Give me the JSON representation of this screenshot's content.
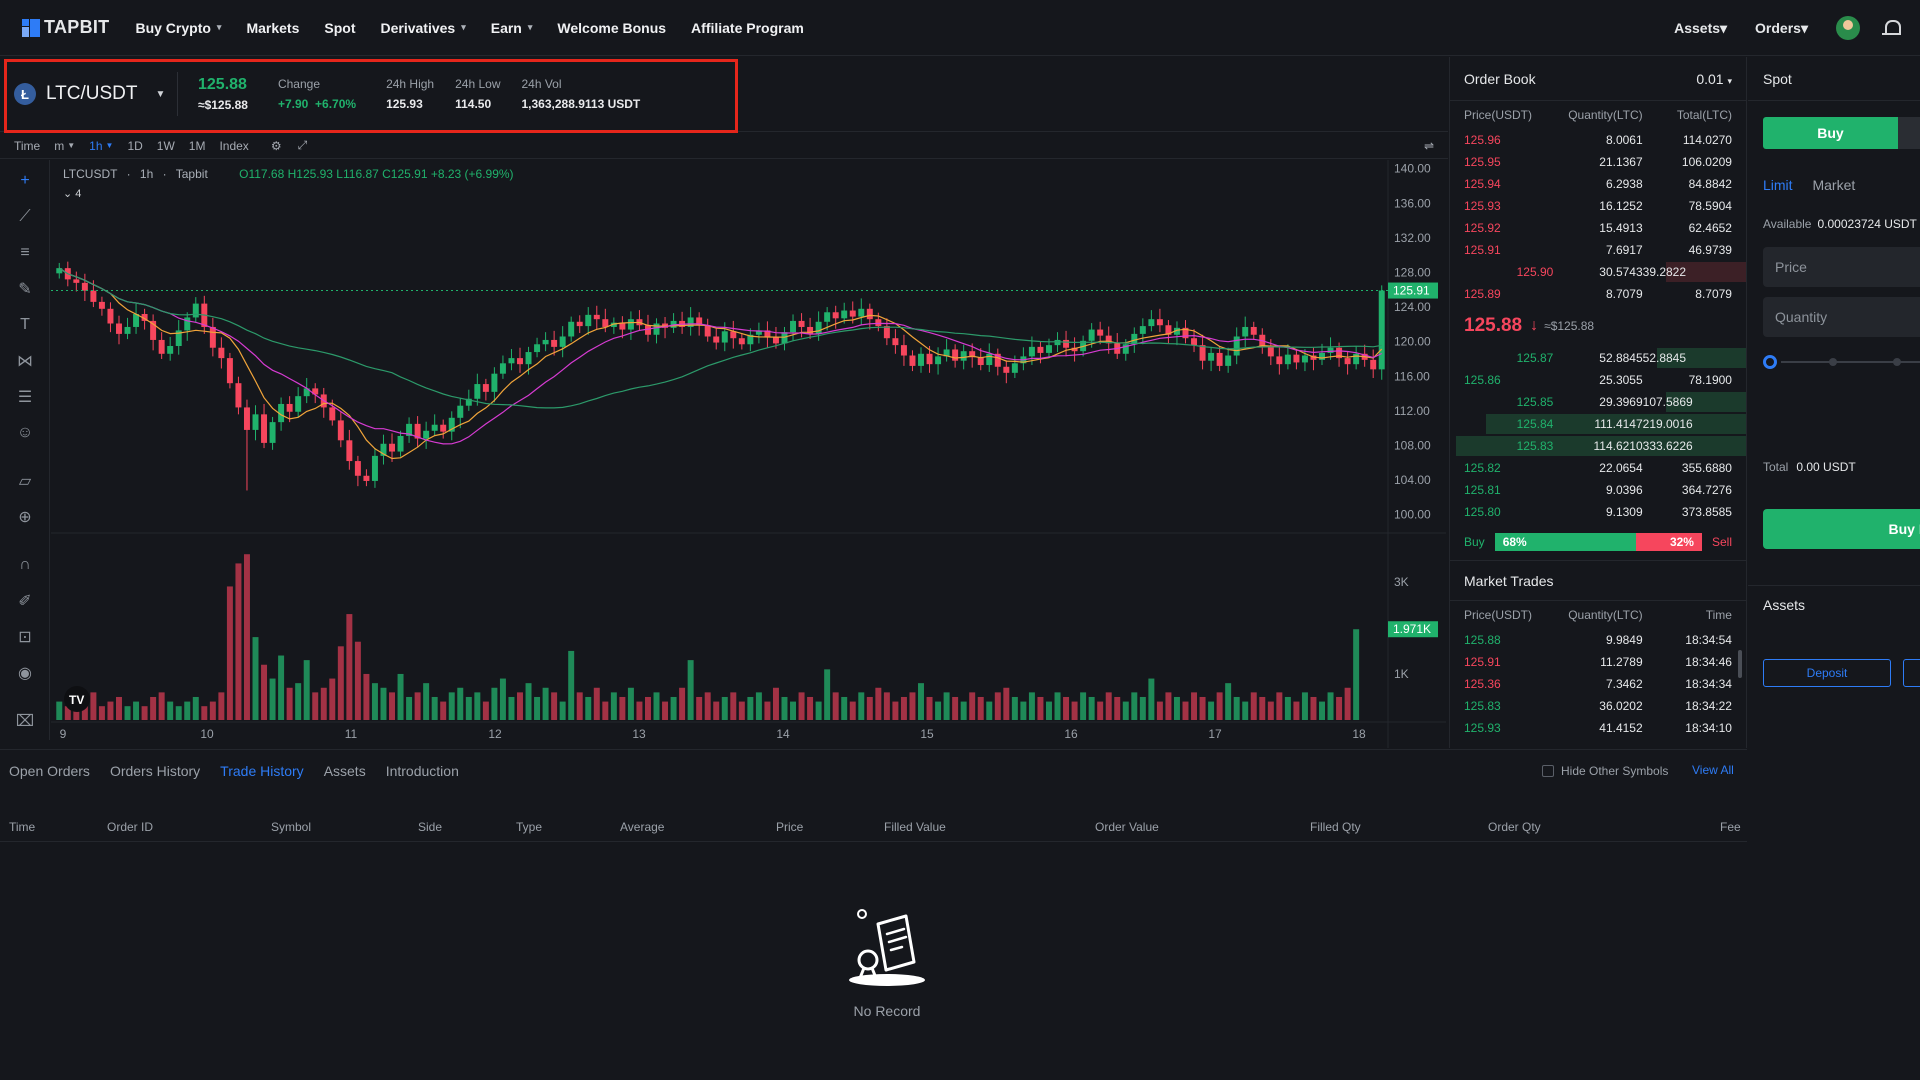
{
  "brand": {
    "name": "TAPBIT"
  },
  "nav": {
    "items": [
      {
        "label": "Buy Crypto",
        "caret": true
      },
      {
        "label": "Markets",
        "caret": false
      },
      {
        "label": "Spot",
        "caret": false
      },
      {
        "label": "Derivatives",
        "caret": true
      },
      {
        "label": "Earn",
        "caret": true
      },
      {
        "label": "Welcome Bonus",
        "caret": false
      },
      {
        "label": "Affiliate Program",
        "caret": false
      }
    ],
    "right": {
      "assets": "Assets",
      "orders": "Orders"
    }
  },
  "ticker": {
    "pair": "LTC/USDT",
    "coin_glyph": "Ł",
    "last_price": "125.88",
    "last_price_ref": "≈$125.88",
    "change_label": "Change",
    "change_abs": "+7.90",
    "change_pct": "+6.70%",
    "high_label": "24h High",
    "high": "125.93",
    "low_label": "24h Low",
    "low": "114.50",
    "vol_label": "24h Vol",
    "vol": "1,363,288.9113 USDT"
  },
  "chart_toolbar": {
    "items": [
      "Time",
      "m",
      "1h",
      "1D",
      "1W",
      "1M",
      "Index"
    ],
    "active": "1h"
  },
  "chart_header": {
    "symbol": "LTCUSDT",
    "interval": "1h",
    "source": "Tapbit",
    "ohlc": "O117.68  H125.93  L116.87  C125.91  +8.23 (+6.99%)",
    "indicator_count": "4"
  },
  "chart_data": {
    "type": "candlestick",
    "price_ticks": [
      "140.00",
      "136.00",
      "132.00",
      "128.00",
      "124.00",
      "120.00",
      "116.00",
      "112.00",
      "108.00",
      "104.00",
      "100.00"
    ],
    "current_price_label": "125.91",
    "volume_ticks": [
      "3K",
      "1K"
    ],
    "current_volume_label": "1.971K",
    "x_ticks": [
      "9",
      "10",
      "11",
      "12",
      "13",
      "14",
      "15",
      "16",
      "17",
      "18"
    ],
    "ylim": [
      98,
      141
    ],
    "closes": [
      128.5,
      127.2,
      126.8,
      125.9,
      124.6,
      123.8,
      122.1,
      120.9,
      121.7,
      123.2,
      122.4,
      120.2,
      118.6,
      119.5,
      121.3,
      122.8,
      124.4,
      121.7,
      119.3,
      118.1,
      115.2,
      112.4,
      109.8,
      111.6,
      108.3,
      110.7,
      112.8,
      111.9,
      113.7,
      114.6,
      113.9,
      112.4,
      110.9,
      108.6,
      106.2,
      104.5,
      103.9,
      106.8,
      108.2,
      107.3,
      109.1,
      110.5,
      108.8,
      109.7,
      110.4,
      109.6,
      111.2,
      112.6,
      113.4,
      115.1,
      114.2,
      116.3,
      117.5,
      118.1,
      117.4,
      118.8,
      119.7,
      120.2,
      119.4,
      120.6,
      122.3,
      121.8,
      123.1,
      122.6,
      121.7,
      122.2,
      121.4,
      122.6,
      121.9,
      120.8,
      122.1,
      121.6,
      122.4,
      121.7,
      122.8,
      121.9,
      120.6,
      119.9,
      121.2,
      120.4,
      119.7,
      120.8,
      121.3,
      120.5,
      119.8,
      121.1,
      122.4,
      121.7,
      120.9,
      122.3,
      123.4,
      122.7,
      123.6,
      122.9,
      123.8,
      122.6,
      121.8,
      120.4,
      119.6,
      118.4,
      117.2,
      118.6,
      117.4,
      118.3,
      119.1,
      117.8,
      118.9,
      118.2,
      117.3,
      118.6,
      117.1,
      116.4,
      117.5,
      118.3,
      119.4,
      118.7,
      119.6,
      120.2,
      119.3,
      118.9,
      120.1,
      121.4,
      120.7,
      119.8,
      118.6,
      119.7,
      120.9,
      121.8,
      122.6,
      121.9,
      120.8,
      121.6,
      120.4,
      119.6,
      117.8,
      118.7,
      117.2,
      118.4,
      120.6,
      121.7,
      120.8,
      119.4,
      118.3,
      117.4,
      118.5,
      117.6,
      118.4,
      117.9,
      118.7,
      119.3,
      118.1,
      117.4,
      118.6,
      117.9,
      116.8,
      125.91
    ],
    "volumes": [
      0.4,
      0.3,
      0.5,
      0.4,
      0.6,
      0.3,
      0.4,
      0.5,
      0.3,
      0.4,
      0.3,
      0.5,
      0.6,
      0.4,
      0.3,
      0.4,
      0.5,
      0.3,
      0.4,
      0.6,
      2.9,
      3.4,
      3.6,
      1.8,
      1.2,
      0.9,
      1.4,
      0.7,
      0.8,
      1.3,
      0.6,
      0.7,
      0.9,
      1.6,
      2.3,
      1.7,
      1.0,
      0.8,
      0.7,
      0.6,
      1.0,
      0.5,
      0.6,
      0.8,
      0.5,
      0.4,
      0.6,
      0.7,
      0.5,
      0.6,
      0.4,
      0.7,
      0.9,
      0.5,
      0.6,
      0.8,
      0.5,
      0.7,
      0.6,
      0.4,
      1.5,
      0.6,
      0.5,
      0.7,
      0.4,
      0.6,
      0.5,
      0.7,
      0.4,
      0.5,
      0.6,
      0.4,
      0.5,
      0.7,
      1.3,
      0.5,
      0.6,
      0.4,
      0.5,
      0.6,
      0.4,
      0.5,
      0.6,
      0.4,
      0.7,
      0.5,
      0.4,
      0.6,
      0.5,
      0.4,
      1.1,
      0.6,
      0.5,
      0.4,
      0.6,
      0.5,
      0.7,
      0.6,
      0.4,
      0.5,
      0.6,
      0.8,
      0.5,
      0.4,
      0.6,
      0.5,
      0.4,
      0.6,
      0.5,
      0.4,
      0.6,
      0.7,
      0.5,
      0.4,
      0.6,
      0.5,
      0.4,
      0.6,
      0.5,
      0.4,
      0.6,
      0.5,
      0.4,
      0.6,
      0.5,
      0.4,
      0.6,
      0.5,
      0.9,
      0.4,
      0.6,
      0.5,
      0.4,
      0.6,
      0.5,
      0.4,
      0.6,
      0.8,
      0.5,
      0.4,
      0.6,
      0.5,
      0.4,
      0.6,
      0.5,
      0.4,
      0.6,
      0.5,
      0.4,
      0.6,
      0.5,
      0.7,
      1.971
    ],
    "volume_max": 3.8
  },
  "order_book": {
    "title": "Order Book",
    "precision": "0.01",
    "columns": [
      "Price(USDT)",
      "Quantity(LTC)",
      "Total(LTC)"
    ],
    "asks": [
      [
        "125.96",
        "8.0061",
        "114.0270",
        0.0
      ],
      [
        "125.95",
        "21.1367",
        "106.0209",
        0.0
      ],
      [
        "125.94",
        "6.2938",
        "84.8842",
        0.0
      ],
      [
        "125.93",
        "16.1252",
        "78.5904",
        0.0
      ],
      [
        "125.92",
        "15.4913",
        "62.4652",
        0.0
      ],
      [
        "125.91",
        "7.6917",
        "46.9739",
        0.0
      ],
      [
        "125.90",
        "30.5743",
        "39.2822",
        0.27
      ],
      [
        "125.89",
        "8.7079",
        "8.7079",
        0.0
      ]
    ],
    "mid_price": "125.88",
    "mid_ref": "≈$125.88",
    "bids": [
      [
        "125.87",
        "52.8845",
        "52.8845",
        0.3
      ],
      [
        "125.86",
        "25.3055",
        "78.1900",
        0.0
      ],
      [
        "125.85",
        "29.3969",
        "107.5869",
        0.27
      ],
      [
        "125.84",
        "111.4147",
        "219.0016",
        0.88
      ],
      [
        "125.83",
        "114.6210",
        "333.6226",
        0.98
      ],
      [
        "125.82",
        "22.0654",
        "355.6880",
        0.0
      ],
      [
        "125.81",
        "9.0396",
        "364.7276",
        0.0
      ],
      [
        "125.80",
        "9.1309",
        "373.8585",
        0.0
      ]
    ],
    "buy_label": "Buy",
    "sell_label": "Sell",
    "buy_pct": "68%",
    "sell_pct": "32%",
    "buy_ratio": 0.68
  },
  "market_trades": {
    "title": "Market Trades",
    "columns": [
      "Price(USDT)",
      "Quantity(LTC)",
      "Time"
    ],
    "rows": [
      [
        "125.88",
        "9.9849",
        "18:34:54",
        "up"
      ],
      [
        "125.91",
        "11.2789",
        "18:34:46",
        "down"
      ],
      [
        "125.36",
        "7.3462",
        "18:34:34",
        "down"
      ],
      [
        "125.83",
        "36.0202",
        "18:34:22",
        "up"
      ],
      [
        "125.93",
        "41.4152",
        "18:34:10",
        "up"
      ]
    ]
  },
  "spot_panel": {
    "title": "Spot",
    "buy_tab": "Buy",
    "limit": "Limit",
    "market": "Market",
    "available_label": "Available",
    "available_value": "0.00023724 USDT",
    "price_placeholder": "Price",
    "quantity_placeholder": "Quantity",
    "total_label": "Total",
    "total_value": "0.00 USDT",
    "buy_button": "Buy LTC",
    "assets_title": "Assets",
    "deposit": "Deposit"
  },
  "orders_panel": {
    "tabs": [
      "Open Orders",
      "Orders History",
      "Trade History",
      "Assets",
      "Introduction"
    ],
    "active_tab": "Trade History",
    "hide_other": "Hide Other Symbols",
    "view_all": "View All",
    "columns": [
      "Time",
      "Order ID",
      "Symbol",
      "Side",
      "Type",
      "Average",
      "Price",
      "Filled Value",
      "Order Value",
      "Filled Qty",
      "Order Qty",
      "Fee"
    ],
    "empty_text": "No Record"
  },
  "colors": {
    "up": "#20b26c",
    "down": "#f6465d",
    "accent": "#2e7cf6"
  }
}
